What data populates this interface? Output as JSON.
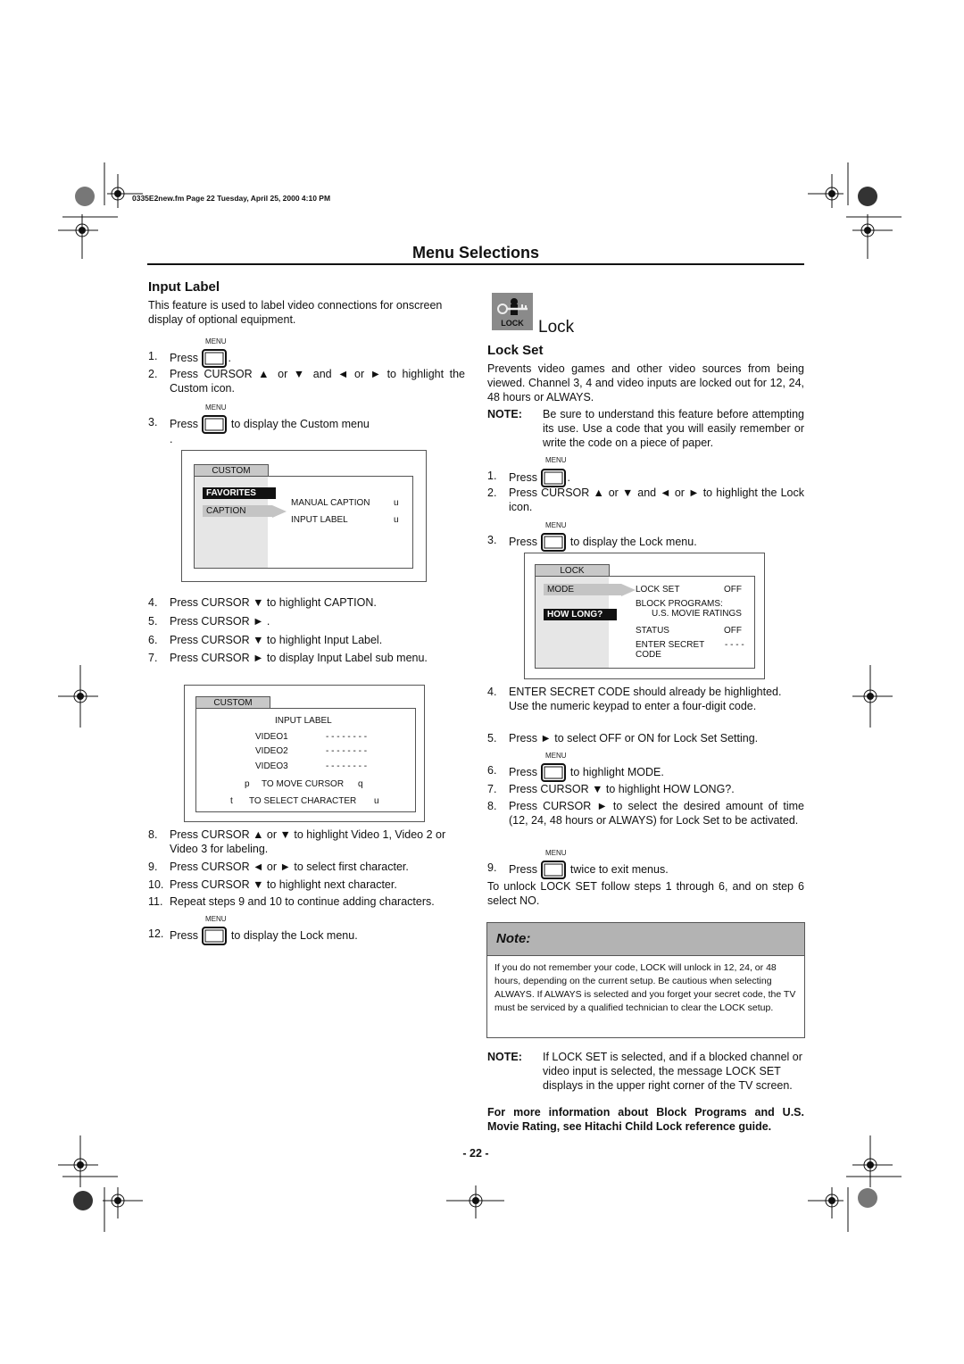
{
  "header": {
    "file_info": "0335E2new.fm  Page 22  Tuesday, April 25, 2000  4:10 PM"
  },
  "page_title": "Menu Selections",
  "left": {
    "heading": "Input Label",
    "intro": "This feature is used to label video connections for onscreen display of optional equipment.",
    "menu_key_label": "MENU",
    "steps": [
      {
        "num": "1.",
        "pre": "Press",
        "post": ".",
        "has_key": true
      },
      {
        "num": "2.",
        "text": "Press CURSOR ▲ or ▼ and ◄ or ► to highlight the Custom icon."
      },
      {
        "num": "3.",
        "pre": "Press",
        "post": "to display the Custom menu",
        "has_key": true,
        "trail": "."
      },
      {
        "num": "4.",
        "text": "Press CURSOR ▼ to highlight CAPTION."
      },
      {
        "num": "5.",
        "text": "Press CURSOR ► ."
      },
      {
        "num": "6.",
        "text": "Press CURSOR ▼ to highlight Input Label."
      },
      {
        "num": "7.",
        "text": "Press CURSOR ► to display Input Label sub menu."
      },
      {
        "num": "8.",
        "text": "Press CURSOR ▲ or ▼ to highlight Video 1, Video 2 or Video 3 for labeling."
      },
      {
        "num": "9.",
        "text": "Press CURSOR ◄ or ► to select first character."
      },
      {
        "num": "10.",
        "text": "Press CURSOR ▼ to highlight next character."
      },
      {
        "num": "11.",
        "text": "Repeat steps 9 and 10 to continue adding characters."
      },
      {
        "num": "12.",
        "pre": "Press",
        "post": "to display the Lock menu.",
        "has_key": true
      }
    ],
    "custom_menu": {
      "tab": "CUSTOM",
      "left_items": [
        "FAVORITES",
        "CAPTION"
      ],
      "right_items": [
        {
          "label": "MANUAL CAPTION",
          "glyph": "u"
        },
        {
          "label": "INPUT LABEL",
          "glyph": "u"
        }
      ]
    },
    "input_label_menu": {
      "tab": "CUSTOM",
      "title": "INPUT LABEL",
      "rows": [
        {
          "label": "VIDEO1",
          "value": "- - - - - - - -"
        },
        {
          "label": "VIDEO2",
          "value": "- - - - - - - -"
        },
        {
          "label": "VIDEO3",
          "value": "- - - - - - - -"
        }
      ],
      "hint_move": {
        "left": "p",
        "text": "TO MOVE CURSOR",
        "right": "q"
      },
      "hint_select": {
        "left": "t",
        "text": "TO SELECT CHARACTER",
        "right": "u"
      }
    }
  },
  "right": {
    "lock_icon_label": "LOCK",
    "section_title": "Lock",
    "heading": "Lock Set",
    "intro": "Prevents video games and other video sources from being viewed. Channel 3, 4 and video inputs are locked out for 12, 24, 48 hours or ALWAYS.",
    "note1_label": "NOTE:",
    "note1_text": "Be sure to understand this feature before attempting its use. Use a code that you will easily remember or write the code on a piece of paper.",
    "menu_key_label": "MENU",
    "steps": [
      {
        "num": "1.",
        "pre": "Press",
        "post": ".",
        "has_key": true
      },
      {
        "num": "2.",
        "text": "Press CURSOR ▲ or ▼ and ◄ or ► to highlight the Lock icon."
      },
      {
        "num": "3.",
        "pre": "Press",
        "post": "to display the Lock menu.",
        "has_key": true
      },
      {
        "num": "4.",
        "text": "ENTER SECRET CODE should already be highlighted. Use the numeric keypad to enter a four-digit code."
      },
      {
        "num": "5.",
        "text": "Press ► to select OFF or ON for Lock Set Setting."
      },
      {
        "num": "6.",
        "pre": "Press",
        "post": "to highlight MODE.",
        "has_key": true
      },
      {
        "num": "7.",
        "text": "Press CURSOR ▼ to highlight HOW LONG?."
      },
      {
        "num": "8.",
        "text": "Press CURSOR ► to select the desired amount of time (12, 24, 48 hours or ALWAYS) for Lock Set to be activated."
      },
      {
        "num": "9.",
        "pre": "Press",
        "post": "twice to exit menus.",
        "has_key": true
      }
    ],
    "unlock_text": "To unlock LOCK SET follow steps 1 through 6, and on step 6 select NO.",
    "lock_menu": {
      "tab": "LOCK",
      "left_items": [
        "MODE",
        "HOW LONG?"
      ],
      "right_items": [
        {
          "label": "LOCK SET",
          "value": "OFF"
        },
        {
          "label": "BLOCK PROGRAMS:",
          "value": ""
        },
        {
          "label": "U.S. MOVIE RATINGS",
          "value": ""
        },
        {
          "label": "STATUS",
          "value": "OFF"
        },
        {
          "label": "ENTER SECRET",
          "value": "- - - -"
        },
        {
          "label": "CODE",
          "value": ""
        }
      ]
    },
    "note_box": {
      "title": "Note:",
      "body": "If you do not remember your code, LOCK will unlock in 12, 24, or 48 hours, depending on the current setup. Be cautious when selecting ALWAYS. If ALWAYS is selected and you forget your secret code, the TV must be serviced by a qualified technician to clear the LOCK setup."
    },
    "note2_label": "NOTE:",
    "note2_text": "If LOCK SET is selected, and if a blocked channel or video input is selected, the message LOCK SET displays in the upper right corner of the TV screen.",
    "more_info": "For more information about Block Programs and U.S. Movie Rating, see Hitachi Child Lock reference guide."
  },
  "page_number": "- 22 -"
}
